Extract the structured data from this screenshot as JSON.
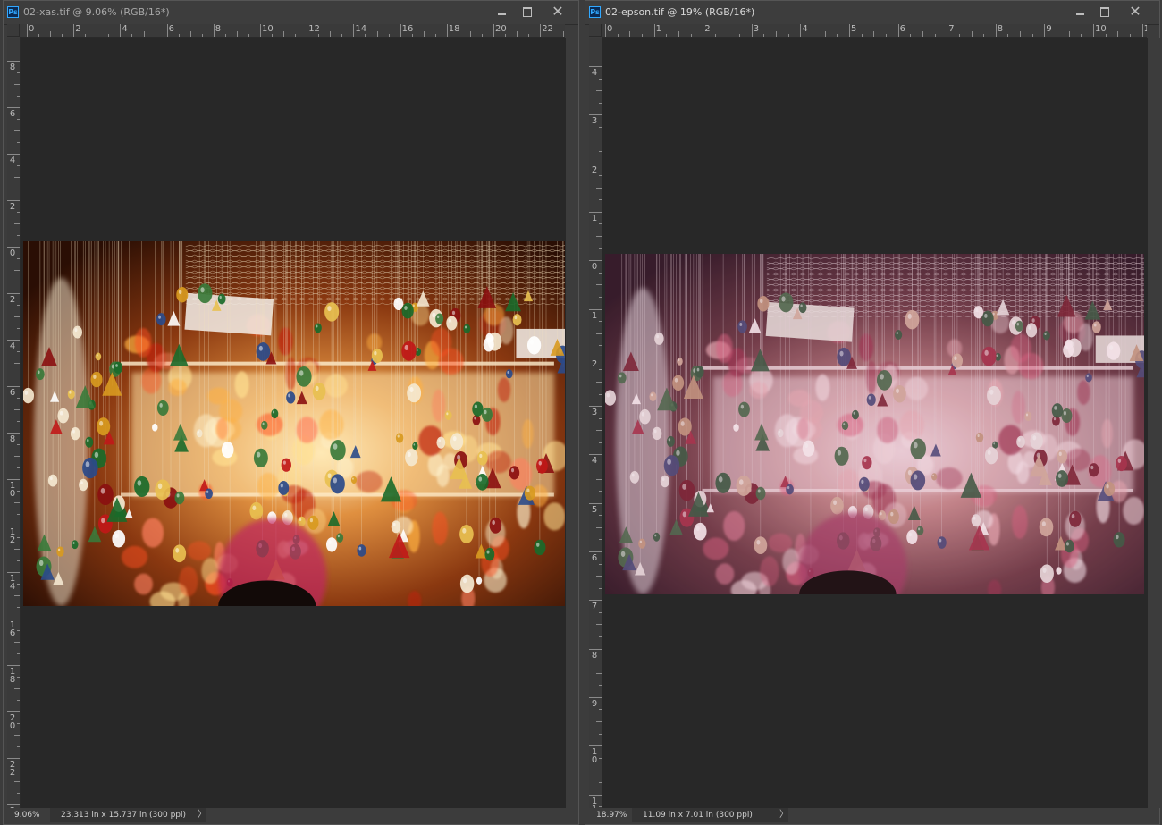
{
  "windows": [
    {
      "title": "02-xas.tif @ 9.06% (RGB/16*)",
      "active": false,
      "hruler_labels": [
        "0",
        "2",
        "4",
        "6",
        "8",
        "10",
        "12",
        "14",
        "16",
        "18",
        "20",
        "22"
      ],
      "vruler_labels": [
        "8",
        "6",
        "4",
        "2",
        "0",
        "2",
        "4",
        "6",
        "8",
        "10",
        "12",
        "14",
        "16",
        "18",
        "20",
        "22",
        "2"
      ],
      "zoom": "9.06%",
      "doc_info": "23.313 in x 15.737 in (300 ppi)",
      "photo_tone": "warm"
    },
    {
      "title": "02-epson.tif @ 19% (RGB/16*)",
      "active": true,
      "hruler_labels": [
        "0",
        "1",
        "2",
        "3",
        "4",
        "5",
        "6",
        "7",
        "8",
        "9",
        "10",
        "1"
      ],
      "vruler_labels": [
        "4",
        "3",
        "2",
        "1",
        "0",
        "1",
        "2",
        "3",
        "4",
        "5",
        "6",
        "7",
        "8",
        "9",
        "10",
        "11"
      ],
      "zoom": "18.97%",
      "doc_info": "11.09 in x 7.01 in (300 ppi)",
      "photo_tone": "muted"
    }
  ],
  "icons": {
    "app": "photoshop-icon",
    "minimize": "minimize-icon",
    "maximize": "maximize-icon",
    "close": "close-icon",
    "status_arrow": "chevron-right-icon"
  },
  "colors": {
    "canvas": "#282828",
    "chrome": "#3c3c3c",
    "ps_blue": "#31a8ff"
  }
}
